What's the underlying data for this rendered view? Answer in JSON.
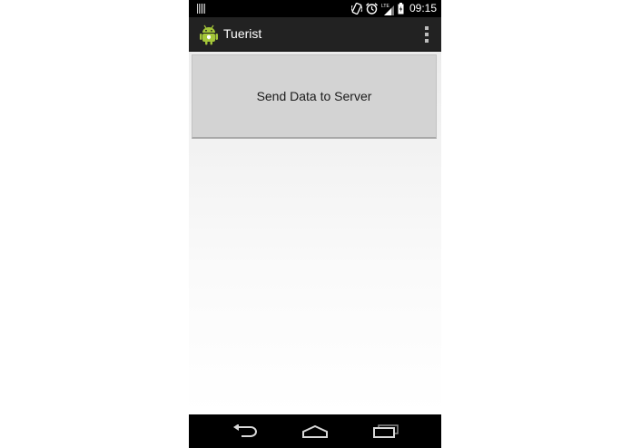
{
  "status_bar": {
    "time": "09:15",
    "network": "LTE",
    "icons": [
      "notification-icon",
      "vibrate-icon",
      "alarm-icon",
      "signal-icon",
      "battery-icon"
    ]
  },
  "action_bar": {
    "title": "Tuerist",
    "app_icon": "android-icon",
    "overflow_icon": "overflow-menu-icon"
  },
  "main": {
    "send_button_label": "Send Data to Server"
  },
  "nav_bar": {
    "icons": [
      "back-icon",
      "home-icon",
      "recent-apps-icon"
    ]
  },
  "colors": {
    "action_bar": "#222222",
    "status_bar": "#000000",
    "button": "#d3d3d3",
    "android_green": "#a4c639"
  }
}
